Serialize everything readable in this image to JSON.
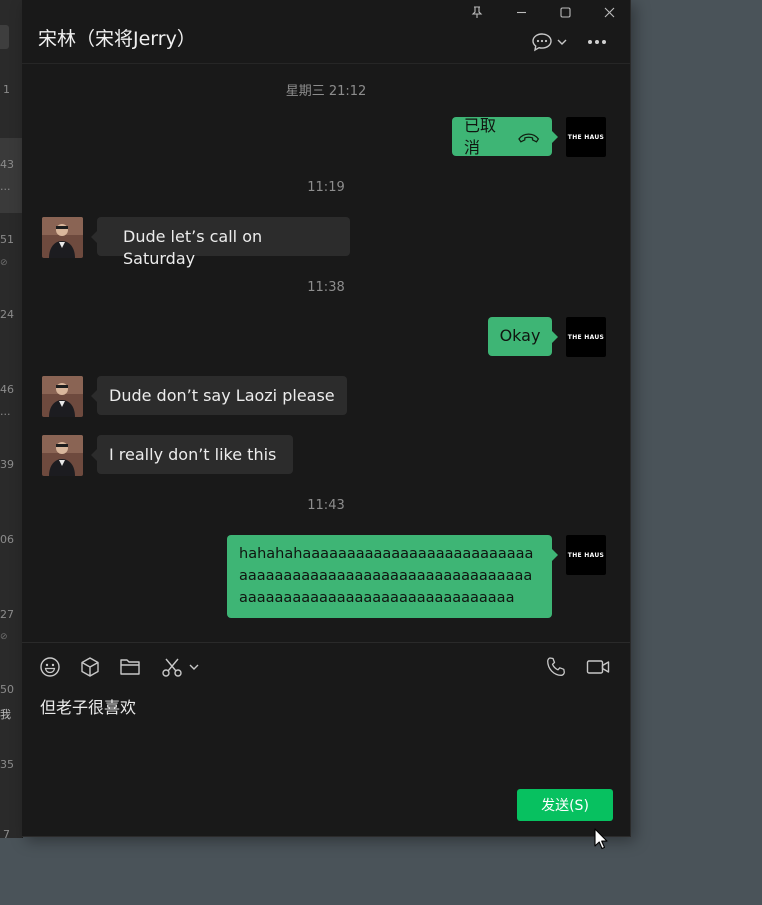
{
  "sidebar_strip": {
    "numbers": [
      "1",
      "43",
      "51",
      "24",
      "46",
      "39",
      "06",
      "27",
      "50",
      "35",
      "7"
    ],
    "dots": [
      "...",
      "...",
      "..."
    ],
    "chars": [
      "我"
    ]
  },
  "chat": {
    "title": "宋林（宋将Jerry）",
    "messages": [
      {
        "type": "time",
        "text": "星期三 21:12"
      },
      {
        "type": "out",
        "text": "已取消",
        "icon": "phone-hangup-icon"
      },
      {
        "type": "time",
        "text": "11:19"
      },
      {
        "type": "in",
        "text": "Dude let’s call on Saturday"
      },
      {
        "type": "time",
        "text": "11:38"
      },
      {
        "type": "out",
        "text": "Okay"
      },
      {
        "type": "in",
        "text": "Dude don’t say Laozi please"
      },
      {
        "type": "in",
        "text": "I really don’t like this"
      },
      {
        "type": "time",
        "text": "11:43"
      },
      {
        "type": "out",
        "text": "hahahahaaaaaaaaaaaaaaaaaaaaaaaaaaaaaaaaaaaaaaaaaaaaaaaaaaaaaaaaaaaaaaaaaaaaaaaaaaaaaaaaaaaaaaaaaa"
      }
    ],
    "my_avatar_logo": "THE HAUS"
  },
  "composer": {
    "draft": "但老子很喜欢",
    "send_label": "发送(S)"
  },
  "colors": {
    "out_bubble": "#3eb575",
    "in_bubble": "#2c2c2c",
    "send_button": "#07c160",
    "window_bg": "#191919"
  }
}
